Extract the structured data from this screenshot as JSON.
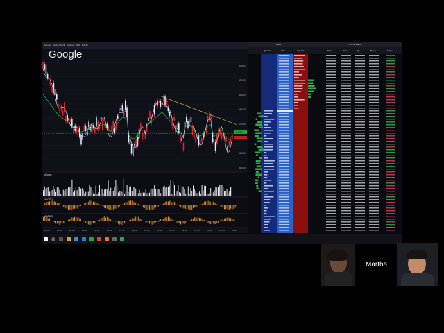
{
  "chart_window": {
    "title_bar": "Google · Media Mobili · Bollinger · RSI · MACD",
    "symbol_overlay": "Google",
    "price_axis": [
      "89.500",
      "89.000",
      "88.500",
      "88.000",
      "87.500",
      "87.000",
      "86.500",
      "86.000"
    ],
    "current_price_label": "87.61",
    "volume_label": "Volume",
    "indicator1_label": "MACD 1",
    "indicator2_label": "MACD 2",
    "time_axis": [
      "10:15",
      "10:30",
      "10:45",
      "11:00",
      "11:15",
      "11:30",
      "11:45",
      "12:00",
      "12:15",
      "12:30",
      "12:45",
      "13:00",
      "13:15",
      "13:30",
      "13:45",
      "14:00"
    ]
  },
  "dom_window": {
    "title": "Book",
    "columns": [
      "Qty Bid",
      "Price",
      "Qty Ask"
    ]
  },
  "ts_window": {
    "title": "Time & Sales",
    "columns": [
      "Time",
      "Price",
      "Qty",
      "Buyer",
      "Seller"
    ]
  },
  "webcam": {
    "name": "Martha"
  },
  "colors": {
    "bull": "#e8e8ff",
    "bear": "#e0202a",
    "ma_green": "#1fa83a",
    "ma_yellow": "#d9c44a",
    "bid": "#2b63c8",
    "ask": "#c41d1d",
    "ts_buy": "#2ca84d",
    "ts_sell": "#c83a5a"
  }
}
